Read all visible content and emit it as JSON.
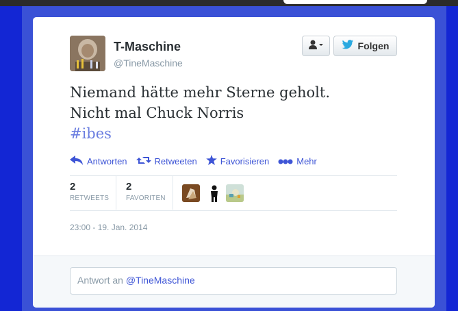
{
  "tweet": {
    "author": {
      "name": "T-Maschine",
      "handle": "@TineMaschine"
    },
    "buttons": {
      "follow_label": "Folgen",
      "user_dropdown_icon": "user-dropdown-icon"
    },
    "text_line1": "Niemand hätte mehr Sterne geholt.",
    "text_line2": "Nicht mal Chuck Norris",
    "hashtag": "#ibes",
    "actions": {
      "reply": "Antworten",
      "retweet": "Retweeten",
      "favorite": "Favorisieren",
      "more": "Mehr"
    },
    "stats": {
      "retweets_count": "2",
      "retweets_label": "RETWEETS",
      "favorites_count": "2",
      "favorites_label": "FAVORITEN"
    },
    "timestamp": "23:00 - 19. Jan. 2014",
    "reply": {
      "prefix": "Antwort an",
      "mention": "@TineMaschine"
    }
  },
  "colors": {
    "background": "#1326d4",
    "link": "#3e55d6",
    "hashtag": "#6b7ee0",
    "twitter_bird": "#2aa9e0"
  }
}
